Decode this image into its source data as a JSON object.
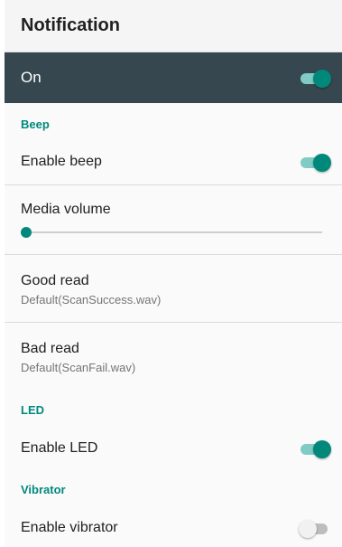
{
  "appbar": {
    "title": "Notification"
  },
  "master": {
    "label": "On",
    "on": true
  },
  "sections": {
    "beep": {
      "title": "Beep",
      "enable_beep": {
        "label": "Enable beep",
        "on": true
      },
      "media_volume": {
        "label": "Media volume",
        "level_fraction": 0.0
      },
      "good_read": {
        "label": "Good read",
        "value": "Default(ScanSuccess.wav)"
      },
      "bad_read": {
        "label": "Bad read",
        "value": "Default(ScanFail.wav)"
      }
    },
    "led": {
      "title": "LED",
      "enable_led": {
        "label": "Enable LED",
        "on": true
      }
    },
    "vibrator": {
      "title": "Vibrator",
      "enable_vibrator": {
        "label": "Enable vibrator",
        "on": false
      }
    }
  },
  "colors": {
    "accent": "#00897b",
    "header_bar": "#37474f",
    "section_title": "#00897b"
  }
}
